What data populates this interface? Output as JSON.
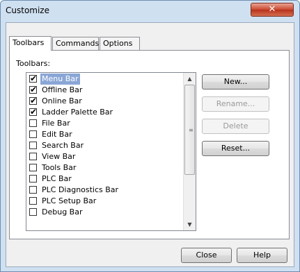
{
  "window": {
    "title": "Customize",
    "close_glyph": "✕"
  },
  "tabs": [
    {
      "label": "Toolbars",
      "active": true
    },
    {
      "label": "Commands",
      "active": false
    },
    {
      "label": "Options",
      "active": false
    }
  ],
  "toolbars_label": "Toolbars:",
  "toolbars": [
    {
      "label": "Menu Bar",
      "checked": true,
      "selected": true
    },
    {
      "label": "Offline Bar",
      "checked": true,
      "selected": false
    },
    {
      "label": "Online Bar",
      "checked": true,
      "selected": false
    },
    {
      "label": "Ladder Palette Bar",
      "checked": true,
      "selected": false
    },
    {
      "label": "File Bar",
      "checked": false,
      "selected": false
    },
    {
      "label": "Edit Bar",
      "checked": false,
      "selected": false
    },
    {
      "label": "Search Bar",
      "checked": false,
      "selected": false
    },
    {
      "label": "View Bar",
      "checked": false,
      "selected": false
    },
    {
      "label": "Tools Bar",
      "checked": false,
      "selected": false
    },
    {
      "label": "PLC Bar",
      "checked": false,
      "selected": false
    },
    {
      "label": "PLC Diagnostics Bar",
      "checked": false,
      "selected": false
    },
    {
      "label": "PLC Setup Bar",
      "checked": false,
      "selected": false
    },
    {
      "label": "Debug Bar",
      "checked": false,
      "selected": false
    }
  ],
  "buttons": {
    "new": "New...",
    "rename": "Rename...",
    "delete": "Delete",
    "reset": "Reset...",
    "close": "Close",
    "help": "Help"
  },
  "colors": {
    "selection": "#8aa6d6",
    "close_button": "#c9472e"
  }
}
